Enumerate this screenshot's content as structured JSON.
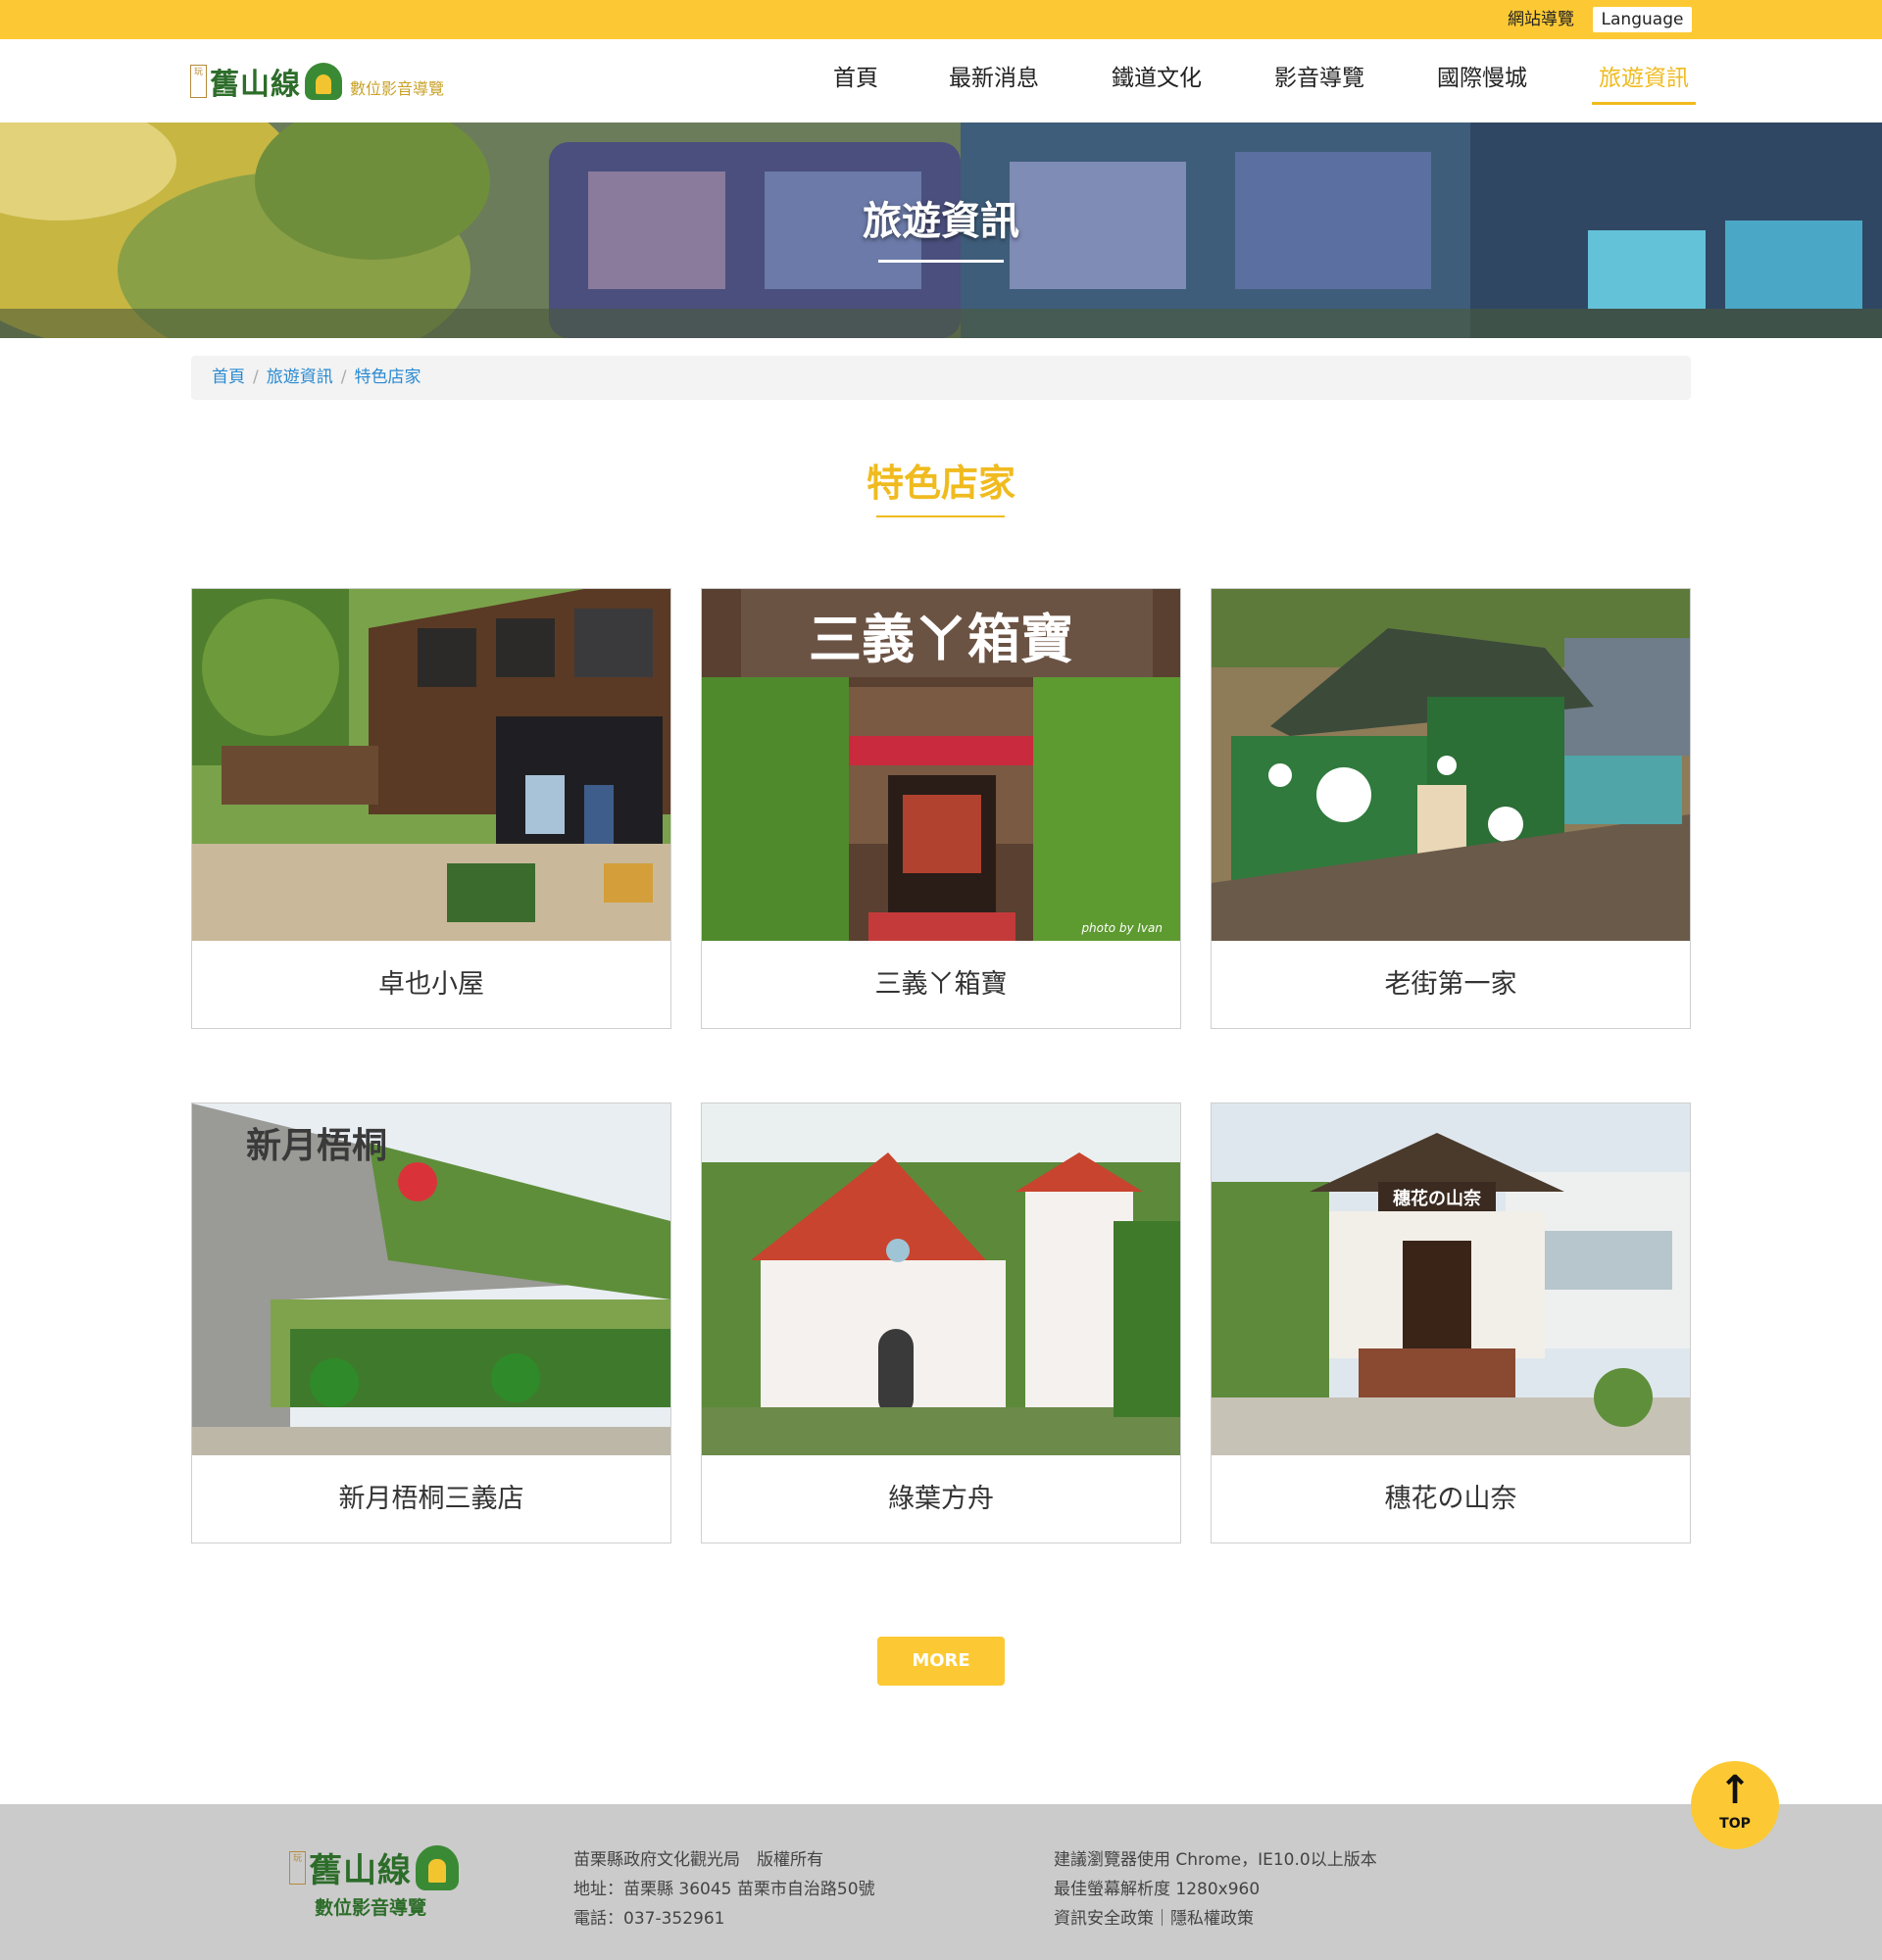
{
  "topbar": {
    "sitemap": "網站導覽",
    "language": "Language"
  },
  "header": {
    "logo_seal": "玩",
    "logo_title": "舊山線",
    "logo_subtitle": "數位影音導覽",
    "nav": [
      "首頁",
      "最新消息",
      "鐵道文化",
      "影音導覽",
      "國際慢城",
      "旅遊資訊"
    ],
    "active_nav": "旅遊資訊"
  },
  "banner": {
    "title": "旅遊資訊"
  },
  "breadcrumb": [
    "首頁",
    "旅遊資訊",
    "特色店家"
  ],
  "section": {
    "title": "特色店家"
  },
  "cards": [
    {
      "label": "卓也小屋",
      "photo_icon": "wooden-house-photo"
    },
    {
      "label": "三義ㄚ箱寶",
      "photo_icon": "shop-entrance-photo",
      "sign_text": "三義ㄚ箱寶",
      "watermark": "photo by Ivan"
    },
    {
      "label": "老街第一家",
      "photo_icon": "green-painted-house-photo"
    },
    {
      "label": "新月梧桐三義店",
      "photo_icon": "concrete-gate-photo",
      "sign_text": "新月梧桐"
    },
    {
      "label": "綠葉方舟",
      "photo_icon": "white-castle-photo"
    },
    {
      "label": "穗花の山奈",
      "photo_icon": "wooden-cabin-photo",
      "sign_text": "穗花の山奈"
    }
  ],
  "more_button": "MORE",
  "top_button": {
    "arrow": "↑",
    "label": "TOP"
  },
  "footer": {
    "logo_title": "舊山線",
    "logo_subtitle": "數位影音導覽",
    "col1": [
      "苗栗縣政府文化觀光局　版權所有",
      "地址：苗栗縣 36045 苗栗市自治路50號",
      "電話：037-352961"
    ],
    "col2": [
      "建議瀏覽器使用 Chrome，IE10.0以上版本",
      "最佳螢幕解析度 1280x960",
      "資訊安全政策｜隱私權政策"
    ]
  },
  "colors": {
    "accent": "#fcc934",
    "active": "#f0bb1f",
    "link": "#2a8ad1",
    "logo_green": "#2d6d2a",
    "footer_bg": "#cbcbcb"
  }
}
